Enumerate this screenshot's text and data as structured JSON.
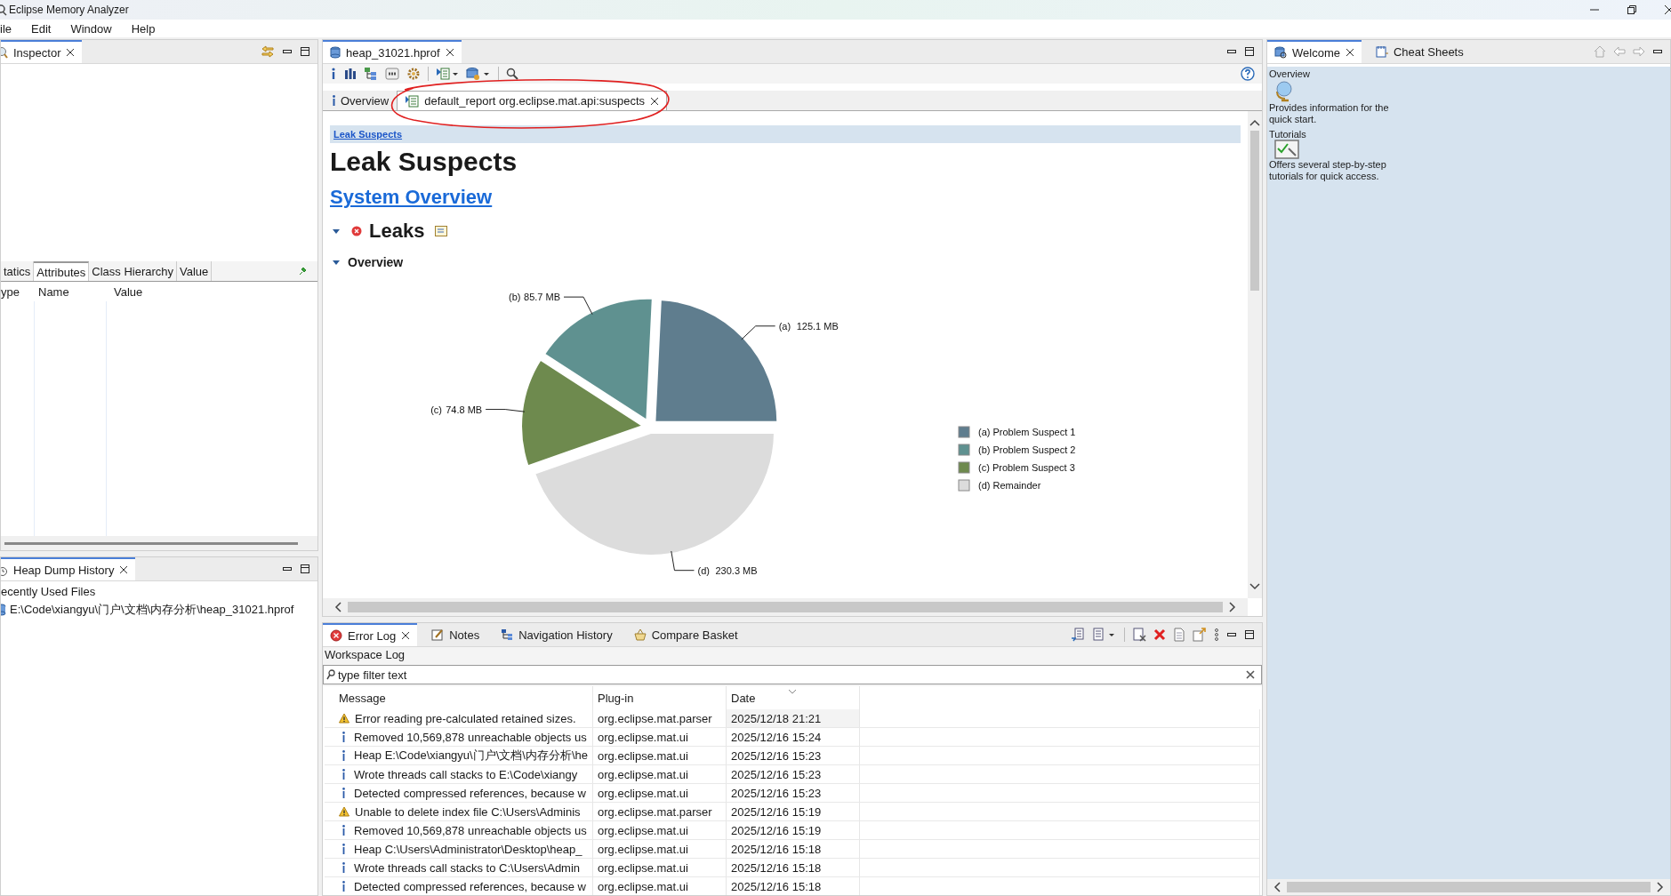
{
  "window": {
    "title": "Eclipse Memory Analyzer"
  },
  "menu": [
    "ile",
    "Edit",
    "Window",
    "Help"
  ],
  "inspector": {
    "tab": "Inspector",
    "tabs": [
      {
        "label": "tatics",
        "selected": false
      },
      {
        "label": "Attributes",
        "selected": true
      },
      {
        "label": "Class Hierarchy",
        "selected": false
      },
      {
        "label": "Value",
        "selected": false
      }
    ],
    "columns": [
      "ype",
      "Name",
      "Value"
    ]
  },
  "heap_dump_history": {
    "tab": "Heap Dump History",
    "section": "ecently Used Files",
    "files": [
      "E:\\Code\\xiangyu\\门户\\文档\\内存分析\\heap_31021.hprof"
    ]
  },
  "editor": {
    "tab": "heap_31021.hprof",
    "report_tabs": [
      {
        "label": "Overview",
        "selected": false,
        "kind": "info"
      },
      {
        "label": "default_report org.eclipse.mat.api:suspects",
        "selected": true,
        "kind": "report"
      }
    ],
    "breadcrumb": "Leak Suspects",
    "heading": "Leak Suspects",
    "system_overview": "System Overview",
    "leaks": {
      "title": "Leaks",
      "expanded": true
    },
    "overview": {
      "title": "Overview",
      "expanded": true,
      "slices": [
        {
          "tag": "(a)",
          "color": "#5f7d8e"
        },
        {
          "tag": "(b)",
          "color": "#5f9190"
        },
        {
          "tag": "(c)",
          "color": "#6e8a4e"
        },
        {
          "tag": "(d)",
          "color": "#dcdcdc"
        }
      ],
      "legend": [
        {
          "tag": "(a)"
        },
        {
          "tag": "(b)"
        },
        {
          "tag": "(c)"
        },
        {
          "tag": "(d)"
        }
      ],
      "chart_data": {
        "type": "pie",
        "categories": [
          "Problem Suspect 1",
          "Problem Suspect 2",
          "Problem Suspect 3",
          "Remainder"
        ],
        "values": [
          125.1,
          85.7,
          74.8,
          230.3
        ],
        "data_labels": true,
        "value_labels": [
          "125.1 MB",
          "85.7 MB",
          "74.8 MB",
          "230.3 MB"
        ]
      }
    }
  },
  "error_log": {
    "tabs": [
      {
        "label": "Error Log",
        "selected": true,
        "kind": "error-log"
      },
      {
        "label": "Notes",
        "selected": false,
        "kind": "notes"
      },
      {
        "label": "Navigation History",
        "selected": false,
        "kind": "history"
      },
      {
        "label": "Compare Basket",
        "selected": false,
        "kind": "basket"
      }
    ],
    "source": "Workspace Log",
    "filter": {
      "placeholder": "type filter text"
    },
    "columns": [
      "Message",
      "Plug-in",
      "Date"
    ],
    "rows": [
      {
        "kind": "warning",
        "message": "Error reading pre-calculated retained sizes.",
        "plugin": "org.eclipse.mat.parser",
        "date": "2025/12/18 21:21"
      },
      {
        "kind": "info",
        "message": "Removed 10,569,878 unreachable objects us",
        "plugin": "org.eclipse.mat.ui",
        "date": "2025/12/16 15:24"
      },
      {
        "kind": "info",
        "message": "Heap E:\\Code\\xiangyu\\门户\\文档\\内存分析\\he",
        "plugin": "org.eclipse.mat.ui",
        "date": "2025/12/16 15:23"
      },
      {
        "kind": "info",
        "message": "Wrote threads call stacks to E:\\Code\\xiangy",
        "plugin": "org.eclipse.mat.ui",
        "date": "2025/12/16 15:23"
      },
      {
        "kind": "info",
        "message": "Detected compressed references, because w",
        "plugin": "org.eclipse.mat.ui",
        "date": "2025/12/16 15:23"
      },
      {
        "kind": "warning",
        "message": "Unable to delete index file C:\\Users\\Adminis",
        "plugin": "org.eclipse.mat.parser",
        "date": "2025/12/16 15:19"
      },
      {
        "kind": "info",
        "message": "Removed 10,569,878 unreachable objects us",
        "plugin": "org.eclipse.mat.ui",
        "date": "2025/12/16 15:19"
      },
      {
        "kind": "info",
        "message": "Heap C:\\Users\\Administrator\\Desktop\\heap_",
        "plugin": "org.eclipse.mat.ui",
        "date": "2025/12/16 15:18"
      },
      {
        "kind": "info",
        "message": "Wrote threads call stacks to C:\\Users\\Admin",
        "plugin": "org.eclipse.mat.ui",
        "date": "2025/12/16 15:18"
      },
      {
        "kind": "info",
        "message": "Detected compressed references, because w",
        "plugin": "org.eclipse.mat.ui",
        "date": "2025/12/16 15:18"
      }
    ]
  },
  "welcome": {
    "tabs": [
      {
        "label": "Welcome",
        "selected": true,
        "kind": "welcome"
      },
      {
        "label": "Cheat Sheets",
        "selected": false,
        "kind": "cheat"
      }
    ],
    "items": [
      {
        "kind": "overview",
        "title": "Overview",
        "description": "Provides information for the quick start."
      },
      {
        "kind": "tutorials",
        "title": "Tutorials",
        "description": "Offers several step-by-step tutorials for quick access."
      }
    ]
  }
}
